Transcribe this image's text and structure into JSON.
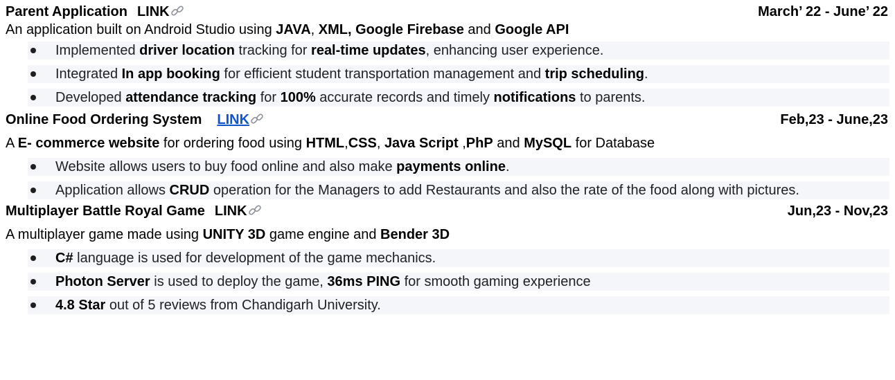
{
  "projects": [
    {
      "title": "Parent Application",
      "link": "LINK",
      "dates": "March’ 22 - June’ 22",
      "description_parts": [
        {
          "t": "An application built on Android Studio using ",
          "b": false
        },
        {
          "t": "JAVA",
          "b": true
        },
        {
          "t": ", ",
          "b": false
        },
        {
          "t": "XML, Google Firebase",
          "b": true
        },
        {
          "t": " and ",
          "b": false
        },
        {
          "t": "Google API",
          "b": true
        }
      ],
      "bullets": [
        [
          {
            "t": "Implemented ",
            "b": false
          },
          {
            "t": "driver location",
            "b": true
          },
          {
            "t": " tracking for ",
            "b": false
          },
          {
            "t": "real-time updates",
            "b": true
          },
          {
            "t": ", enhancing user experience.",
            "b": false
          }
        ],
        [
          {
            "t": "Integrated ",
            "b": false
          },
          {
            "t": "In app booking",
            "b": true
          },
          {
            "t": " for efficient student transportation management and ",
            "b": false
          },
          {
            "t": "trip scheduling",
            "b": true
          },
          {
            "t": ".",
            "b": false
          }
        ],
        [
          {
            "t": "Developed ",
            "b": false
          },
          {
            "t": "attendance tracking",
            "b": true
          },
          {
            "t": " for ",
            "b": false
          },
          {
            "t": "100%",
            "b": true
          },
          {
            "t": " accurate records and timely ",
            "b": false
          },
          {
            "t": "notifications",
            "b": true
          },
          {
            "t": " to parents.",
            "b": false
          }
        ]
      ]
    },
    {
      "title": "Online Food Ordering System",
      "link": "LINK",
      "dates": "Feb,23 - June,23",
      "description_parts": [
        {
          "t": "A ",
          "b": false
        },
        {
          "t": "E- commerce website",
          "b": true
        },
        {
          "t": " for ordering food  using ",
          "b": false
        },
        {
          "t": "HTML",
          "b": true
        },
        {
          "t": ",",
          "b": false
        },
        {
          "t": "CSS",
          "b": true
        },
        {
          "t": ", ",
          "b": false
        },
        {
          "t": "Java Script",
          "b": true
        },
        {
          "t": " ,",
          "b": false
        },
        {
          "t": "PhP",
          "b": true
        },
        {
          "t": " and ",
          "b": false
        },
        {
          "t": "MySQL",
          "b": true
        },
        {
          "t": " for Database",
          "b": false
        }
      ],
      "bullets": [
        [
          {
            "t": "Website allows users to buy food online and also make ",
            "b": false
          },
          {
            "t": "payments online",
            "b": true
          },
          {
            "t": ".",
            "b": false
          }
        ],
        [
          {
            "t": "Application allows ",
            "b": false
          },
          {
            "t": "CRUD",
            "b": true
          },
          {
            "t": " operation for the Managers to add Restaurants and also the rate of the food along with pictures.",
            "b": false
          }
        ]
      ]
    },
    {
      "title": "Multiplayer Battle Royal Game",
      "link": "LINK",
      "dates": "Jun,23 - Nov,23",
      "description_parts": [
        {
          "t": "A multiplayer game made using ",
          "b": false
        },
        {
          "t": "UNITY 3D",
          "b": true
        },
        {
          "t": " game engine and ",
          "b": false
        },
        {
          "t": "Bender 3D",
          "b": true
        }
      ],
      "bullets": [
        [
          {
            "t": "C#",
            "b": true
          },
          {
            "t": " language is used for development of the game mechanics.",
            "b": false
          }
        ],
        [
          {
            "t": "Photon Server",
            "b": true
          },
          {
            "t": " is used to deploy the game, ",
            "b": false
          },
          {
            "t": "36ms PING",
            "b": true
          },
          {
            "t": " for smooth gaming experience",
            "b": false
          }
        ],
        [
          {
            "t": "4.8 Star",
            "b": true
          },
          {
            "t": " out of 5 reviews from Chandigarh University.",
            "b": false
          }
        ]
      ]
    }
  ],
  "icons": {
    "link": "chain-link-icon"
  },
  "colors": {
    "link_blue": "#1155cc",
    "bullet_bg": "#f4f6f9"
  }
}
